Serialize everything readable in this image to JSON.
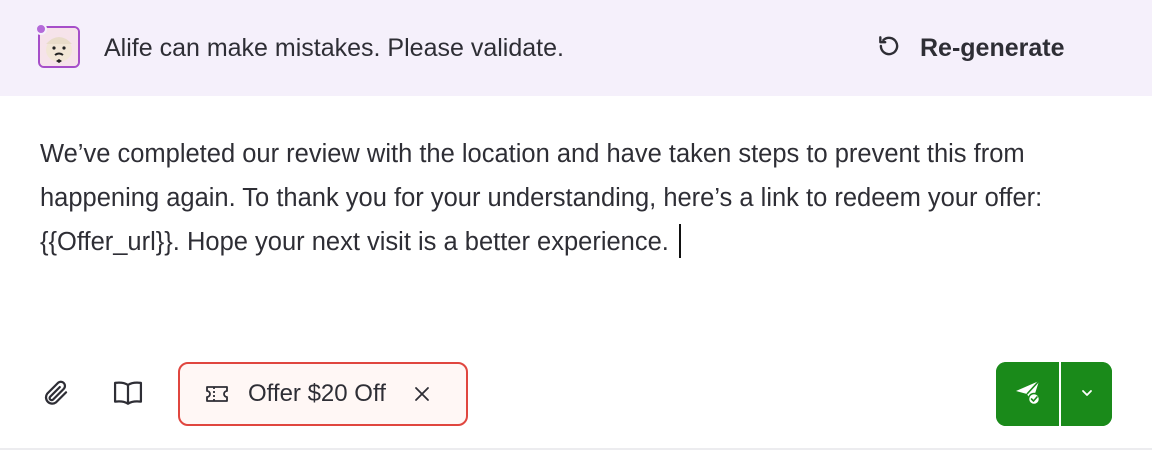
{
  "banner": {
    "disclaimer": "Alife can make mistakes. Please validate.",
    "avatar_icon": "robot-avatar-icon",
    "regenerate_icon": "refresh-icon",
    "regenerate_label": "Re-generate"
  },
  "message": {
    "text": "We’ve completed our review with the location and have taken steps to prevent this from happening again. To thank you for your understanding, here’s a link to redeem your offer: {{Offer_url}}. Hope your next visit is a better experience."
  },
  "toolbar": {
    "attach_icon": "paperclip-icon",
    "knowledge_icon": "book-icon",
    "offer_chip": {
      "icon": "ticket-icon",
      "label": "Offer $20 Off",
      "remove_icon": "close-icon"
    },
    "send": {
      "icon": "paper-plane-check-icon",
      "menu_icon": "chevron-down-icon"
    }
  },
  "colors": {
    "banner_bg": "#f5f0fb",
    "chip_border": "#e0463f",
    "send_green": "#1a8a1a",
    "avatar_border": "#a64ec9"
  }
}
